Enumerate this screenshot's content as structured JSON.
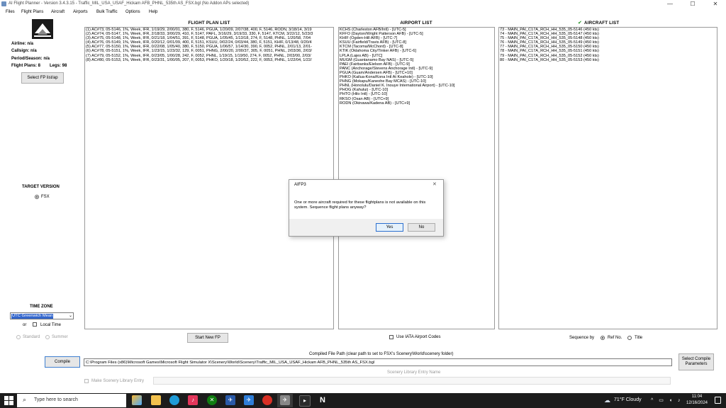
{
  "window": {
    "title": "AI Flight Planner - Version 3.4.3.15 - Traffic_MIL_USA_USAF_Hickam AFB_PHNL_535th AS_FSX.bgl (No Addon APs selected)",
    "minimize": "—",
    "maximize": "☐",
    "close": "✕"
  },
  "menu": [
    "Files",
    "Flight Plans",
    "Aircraft",
    "Airports",
    "Bulk Traffic",
    "Options",
    "Help"
  ],
  "left": {
    "airline": "Airline: n/a",
    "callsign": "Callsign: n/a",
    "period": "Period/Season: n/a",
    "flight_plans": "Flight Plans: 8",
    "legs": "Legs: 98",
    "select_btn": "Select FP list/ap",
    "target_version_title": "TARGET VERSION",
    "fsx_label": "FSX",
    "time_zone_title": "TIME ZONE",
    "time_zone_value": "UTC Greenwich Mean",
    "or": "or",
    "local_time": "Local Time",
    "standard": "Standard",
    "summer": "Summer"
  },
  "flight_plan_list": {
    "title": "FLIGHT PLAN LIST",
    "rows": [
      "(1) AC#73, 05-5146, 1%, Week, IFR, 1/19/29, 2/00/01, 380, F, 5146, PGUA, 1/20/09, 2/07/38, 400, F, 5146, RODN, 3/18/14, 3/19",
      "(2) AC#74, 05-5147, 1%, Week, IFR, 2/18/33, 3/00/29, 410, F, 5147, PAFL, 3/16/29, 3/19/33, 330, F, 5147, KTCM, 3/22/12, 5/23/3",
      "(3) AC#75, 05-5148, 1%, Week, IFR, 0/21/18, 1/04/51, 391, F, 5148, PGUA, 1/05/45, 1/13/18, 274, F, 5148, PHNL, 1/20/58, 7/04",
      "(4) AC#76, 05-5149, 1%, Week, IFR, 0/20/12, 0/01/09, 400, F, 5151, KSUU, 0/02/24, 0/03/44, 380, F, 5151, KHIF, 0/13/48, 0/20/4",
      "(5) AC#77, 05-5150, 1%, Week, IFR, 0/22/08, 1/05/40, 380, F, 5150, PGUA, 1/06/57, 1/14/30, 390, F, 0052, PHNL, 2/01/13, 2/01-",
      "(6) AC#78, 05-5151, 1%, Week, IFR, 1/23/15, 1/23/32, 129, F, 0051, PHNG, 2/00/20, 2/00/37, 305, F, 0051, PHNL, 2/03/36, 2/03/",
      "(7) AC#79, 05-5152, 1%, Week, IFR, 0/23/05, 1/00/28, 242, F, 0052, PHNL, 1/19/15, 1/19/50, 274, F, 0052, PHNL, 2/03/00, 2/03/",
      "(8) AC#80, 05-5153, 1%, Week, IFR, 0/23/31, 1/00/05, 207, F, 0053, PHKO, 1/20/18, 1/20/52, 222, F, 0053, PHNL, 1/22/04, 1/22/"
    ],
    "start_new_fp": "Start New FP"
  },
  "airport_list": {
    "title": "AIRPORT LIST",
    "rows": [
      "KCHS (Charleston AFB/Intl) - [UTC-5]",
      "KFFO (Dayton/Wright Patterson AFB) - [UTC-5]",
      "KHIF (Ogden-Hill AFB) - [UTC-7]",
      "KSUU (Fairfield/Travis AFB) - [UTC-8]",
      "KTCM (Tacoma/McChord) - [UTC-8]",
      "KTIK (Oklahoma City/Tinker AFB) - [UTC-6]",
      "LPLA (Lajes AB) - [UTC]",
      "MUGM (Guantanamo Bay NAS) - [UTC-5]",
      "PAEI (Fairbanks/Eielson AFB) - [UTC-9]",
      "PANC (Anchorage/Stevens Anchorage Intl) - [UTC-9]",
      "PGUA (Guam/Andersen AFB) - [UTC+10]",
      "PHKO (Kailua-Kona/Kona Intl At Keahole) - [UTC-10]",
      "PHNG (Mokapu/Kaneohe Bay MCAS) - [UTC-10]",
      "PHNL (Honolulu/Daniel K. Inouye International Airport) - [UTC-10]",
      "PHOG (Kahului) - [UTC-10]",
      "PHTO (Hilo Intl) - [UTC-10]",
      "RKSO (Osan AB) - [UTC+9]",
      "RODN (Okinawa/Kadena AB) - [UTC+9]"
    ],
    "iata_label": "Use IATA Airport Codes"
  },
  "aircraft_list": {
    "check_mark": "✔",
    "title": "AIRCRAFT LIST",
    "rows": [
      "73 - MAIN_PAI_C17A_RCH_HH_535_05-5146 (450 kts)",
      "74 - MAIN_PAI_C17A_RCH_HH_535_05-5147 (450 kts)",
      "75 - MAIN_PAI_C17A_RCH_HH_535_05-5148 (450 kts)",
      "76 - MAIN_PAI_C17A_RCH_HH_535_05-5149 (450 kts)",
      "77 - MAIN_PAI_C17A_RCH_HH_535_05-5150 (450 kts)",
      "78 - MAIN_PAI_C17A_RCH_HH_535_05-5151 (450 kts)",
      "79 - MAIN_PAI_C17A_RCH_HH_535_05-5152 (450 kts)",
      "80 - MAIN_PAI_C17A_RCH_HH_535_05-5153 (450 kts)"
    ],
    "sequence_by": "Sequence by",
    "ref_no": "Ref No.",
    "title_opt": "Title"
  },
  "bottom": {
    "compiled_label": "Compiled File Path (clear path to set to FSX's Scenery\\World\\scenery folder)",
    "compile_btn": "Compile",
    "path_value": "C:\\Program Files (x86)\\Microsoft Games\\Microsoft Flight Simulator X\\Scenery\\World\\Scenery\\Traffic_MIL_USA_USAF_Hickam AFB_PHNL_535th AS_FSX.bgl",
    "scenery_entry_name": "Scenery Library Entry Name",
    "make_scenery_entry": "Make Scenery Library Entry",
    "select_compile_params": "Select Compile Parameters"
  },
  "dialog": {
    "title": "AIFP3",
    "close": "✕",
    "message": "One or more aircraft required for these flightplans is not available on this system. Sequence flight plans anyway?",
    "yes": "Yes",
    "no": "No"
  },
  "taskbar": {
    "search_placeholder": "Type here to search",
    "weather": "71°F Cloudy",
    "time": "11:04",
    "date": "12/16/2024",
    "icons": [
      "windows-start-icon",
      "search-icon",
      "copilot-icon",
      "file-explorer-icon",
      "edge-icon",
      "music-icon",
      "xbox-icon",
      "flight-icon",
      "chrome-icon",
      "planner-icon",
      "terminal-icon",
      "notion-icon"
    ]
  }
}
